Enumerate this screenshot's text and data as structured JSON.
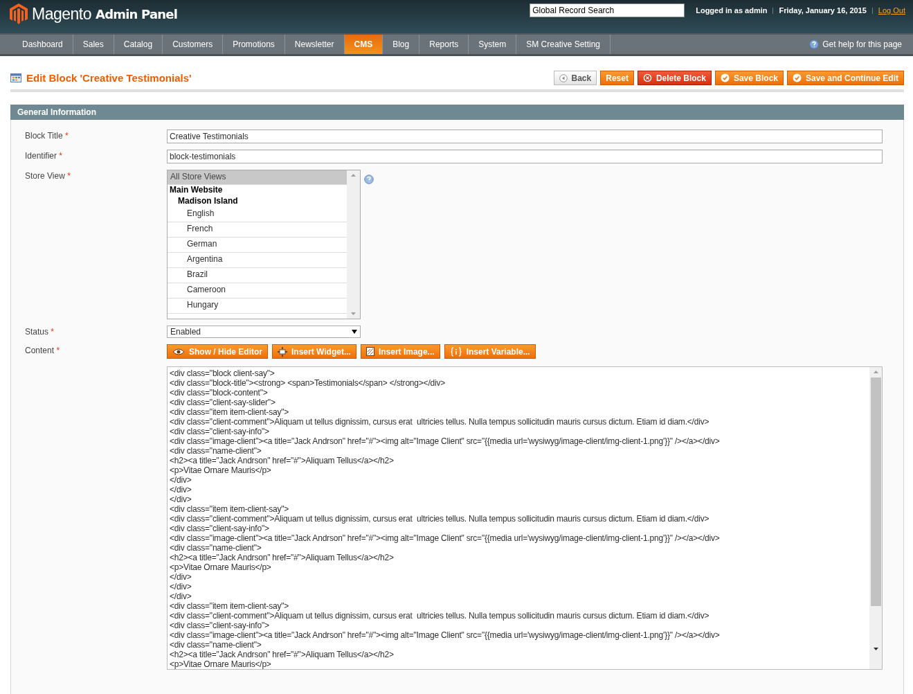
{
  "header": {
    "logo_text": "Magento",
    "logo_suffix": "Admin Panel",
    "search": {
      "value": "Global Record Search"
    },
    "user": "Logged in as admin",
    "date": "Friday, January 16, 2015",
    "logout": "Log Out"
  },
  "nav": {
    "items": [
      {
        "label": "Dashboard",
        "selected": false
      },
      {
        "label": "Sales",
        "selected": false
      },
      {
        "label": "Catalog",
        "selected": false
      },
      {
        "label": "Customers",
        "selected": false
      },
      {
        "label": "Promotions",
        "selected": false
      },
      {
        "label": "Newsletter",
        "selected": false
      },
      {
        "label": "CMS",
        "selected": true
      },
      {
        "label": "Blog",
        "selected": false
      },
      {
        "label": "Reports",
        "selected": false
      },
      {
        "label": "System",
        "selected": false
      },
      {
        "label": "SM Creative Setting",
        "selected": false
      }
    ],
    "help": "Get help for this page"
  },
  "page": {
    "title": "Edit Block 'Creative Testimonials'",
    "buttons": [
      {
        "label": "Back",
        "kind": "back"
      },
      {
        "label": "Reset",
        "kind": "reset"
      },
      {
        "label": "Delete Block",
        "kind": "delete"
      },
      {
        "label": "Save Block",
        "kind": "save"
      },
      {
        "label": "Save and Continue Edit",
        "kind": "save"
      }
    ]
  },
  "section": {
    "title": "General Information",
    "block_title": {
      "label": "Block Title",
      "required_mark": "*",
      "value": "Creative Testimonials"
    },
    "identifier": {
      "label": "Identifier",
      "required_mark": "*",
      "value": "block-testimonials"
    },
    "store_view": {
      "label": "Store View",
      "required_mark": "*",
      "options": [
        {
          "label": "All Store Views",
          "kind": "option",
          "selected": true
        },
        {
          "label": "Main Website",
          "kind": "group"
        },
        {
          "label": "Madison Island",
          "kind": "subgroup"
        },
        {
          "label": "English",
          "kind": "option",
          "selected": false
        },
        {
          "label": "French",
          "kind": "option",
          "selected": false
        },
        {
          "label": "German",
          "kind": "option",
          "selected": false
        },
        {
          "label": "Argentina",
          "kind": "option",
          "selected": false
        },
        {
          "label": "Brazil",
          "kind": "option",
          "selected": false
        },
        {
          "label": "Cameroon",
          "kind": "option",
          "selected": false
        },
        {
          "label": "Hungary",
          "kind": "option",
          "selected": false
        }
      ]
    },
    "status": {
      "label": "Status",
      "required_mark": "*",
      "value": "Enabled"
    },
    "content": {
      "label": "Content",
      "required_mark": "*",
      "buttons": [
        {
          "label": "Show / Hide Editor",
          "kind": "eye"
        },
        {
          "label": "Insert Widget...",
          "kind": "widget"
        },
        {
          "label": "Insert Image...",
          "kind": "image"
        },
        {
          "label": "Insert Variable...",
          "kind": "variable"
        }
      ],
      "lines": [
        "<div class=\"block client-say\">",
        "<div class=\"block-title\"><strong> <span>Testimonials</span> </strong></div>",
        "<div class=\"block-content\">",
        "<div class=\"client-say-slider\">",
        "<div class=\"item item-client-say\">",
        "<div class=\"client-comment\">Aliquam ut tellus dignissim, cursus erat  ultricies tellus. Nulla tempus sollicitudin mauris cursus dictum. Etiam id diam.</div>",
        "<div class=\"client-say-info\">",
        "<div class=\"image-client\"><a title=\"Jack Andrson\" href=\"#\"><img alt=\"Image Client\" src=\"{{media url='wysiwyg/image-client/img-client-1.png'}}\" /></a></div>",
        "<div class=\"name-client\">",
        "<h2><a title=\"Jack Andrson\" href=\"#\">Aliquam Tellus</a></h2>",
        "<p>Vitae Ornare Mauris</p>",
        "</div>",
        "</div>",
        "</div>",
        "<div class=\"item item-client-say\">",
        "<div class=\"client-comment\">Aliquam ut tellus dignissim, cursus erat  ultricies tellus. Nulla tempus sollicitudin mauris cursus dictum. Etiam id diam.</div>",
        "<div class=\"client-say-info\">",
        "<div class=\"image-client\"><a title=\"Jack Andrson\" href=\"#\"><img alt=\"Image Client\" src=\"{{media url='wysiwyg/image-client/img-client-1.png'}}\" /></a></div>",
        "<div class=\"name-client\">",
        "<h2><a title=\"Jack Andrson\" href=\"#\">Aliquam Tellus</a></h2>",
        "<p>Vitae Ornare Mauris</p>",
        "</div>",
        "</div>",
        "</div>",
        "<div class=\"item item-client-say\">",
        "<div class=\"client-comment\">Aliquam ut tellus dignissim, cursus erat  ultricies tellus. Nulla tempus sollicitudin mauris cursus dictum. Etiam id diam.</div>",
        "<div class=\"client-say-info\">",
        "<div class=\"image-client\"><a title=\"Jack Andrson\" href=\"#\"><img alt=\"Image Client\" src=\"{{media url='wysiwyg/image-client/img-client-1.png'}}\" /></a></div>",
        "<div class=\"name-client\">",
        "<h2><a title=\"Jack Andrson\" href=\"#\">Aliquam Tellus</a></h2>",
        "<p>Vitae Ornare Mauris</p>"
      ]
    }
  }
}
